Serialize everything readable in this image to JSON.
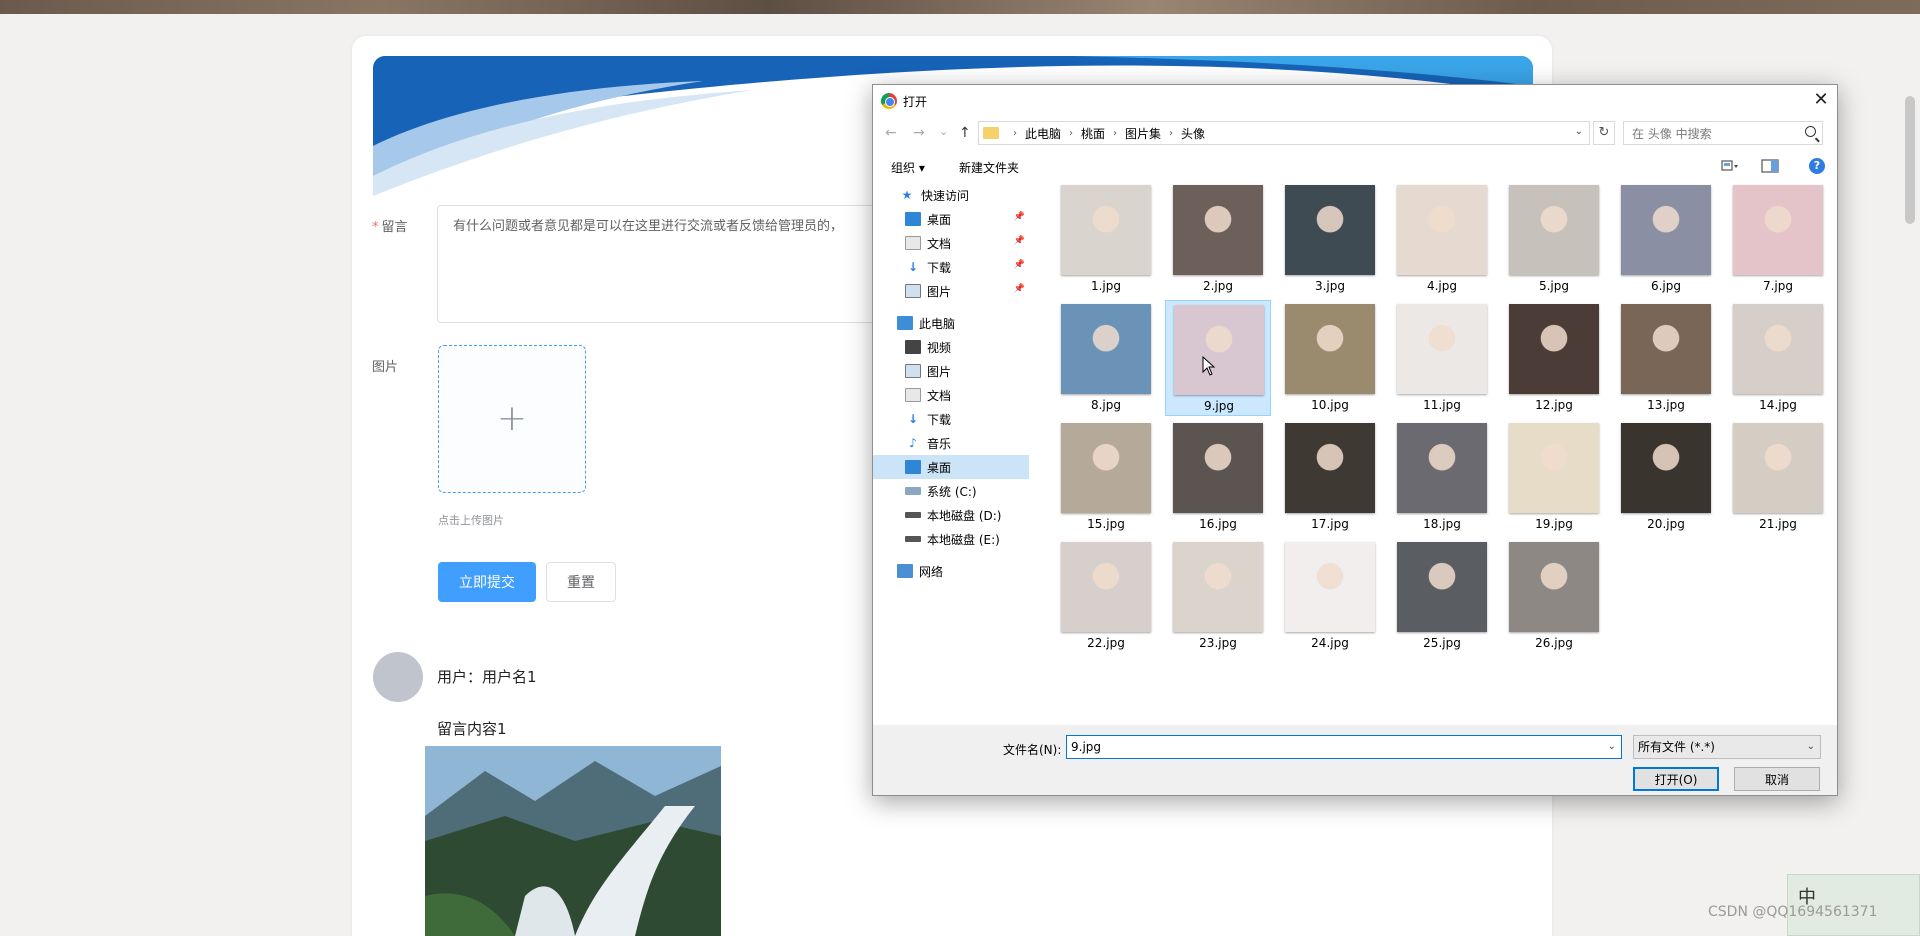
{
  "page": {
    "form": {
      "message_label": "留言",
      "message_placeholder": "有什么问题或者意见都是可以在这里进行交流或者反馈给管理员的，",
      "image_label": "图片",
      "upload_plus": "+",
      "upload_tip": "点击上传图片",
      "submit_label": "立即提交",
      "reset_label": "重置"
    },
    "comment": {
      "user": "用户：用户名1",
      "content": "留言内容1"
    }
  },
  "dialog": {
    "title": "打开",
    "close": "✕",
    "nav": {
      "back": "←",
      "forward": "→",
      "recent": "⌄",
      "up": "↑"
    },
    "breadcrumbs": [
      "此电脑",
      "桃面",
      "图片集",
      "头像"
    ],
    "refresh": "↻",
    "search_placeholder": "在 头像 中搜索",
    "toolbar": {
      "organize": "组织 ▾",
      "new_folder": "新建文件夹",
      "help": "?"
    },
    "sidebar": [
      {
        "label": "快速访问",
        "icon": "star-icon"
      },
      {
        "label": "桌面",
        "icon": "desktop-icon",
        "pinned": true
      },
      {
        "label": "文档",
        "icon": "document-icon",
        "pinned": true
      },
      {
        "label": "下载",
        "icon": "download-icon",
        "pinned": true
      },
      {
        "label": "图片",
        "icon": "picture-icon",
        "pinned": true
      },
      {
        "label": "此电脑",
        "icon": "computer-icon"
      },
      {
        "label": "视频",
        "icon": "video-icon"
      },
      {
        "label": "图片",
        "icon": "picture-icon"
      },
      {
        "label": "文档",
        "icon": "document-icon"
      },
      {
        "label": "下载",
        "icon": "download-icon"
      },
      {
        "label": "音乐",
        "icon": "music-icon"
      },
      {
        "label": "桌面",
        "icon": "desktop-icon",
        "selected": true
      },
      {
        "label": "系统 (C:)",
        "icon": "drive-icon"
      },
      {
        "label": "本地磁盘 (D:)",
        "icon": "drive-icon"
      },
      {
        "label": "本地磁盘 (E:)",
        "icon": "drive-icon"
      },
      {
        "label": "网络",
        "icon": "network-icon"
      }
    ],
    "files": [
      {
        "name": "1.jpg",
        "color": "#d9d4cd"
      },
      {
        "name": "2.jpg",
        "color": "#6d5f5a"
      },
      {
        "name": "3.jpg",
        "color": "#3f4b52"
      },
      {
        "name": "4.jpg",
        "color": "#e6d9cf"
      },
      {
        "name": "5.jpg",
        "color": "#c7c1bc"
      },
      {
        "name": "6.jpg",
        "color": "#8a8fa3"
      },
      {
        "name": "7.jpg",
        "color": "#e4c4c9"
      },
      {
        "name": "8.jpg",
        "color": "#6b93b8"
      },
      {
        "name": "9.jpg",
        "color": "#d8c7d0",
        "selected": true
      },
      {
        "name": "10.jpg",
        "color": "#9a8a6e"
      },
      {
        "name": "11.jpg",
        "color": "#ece8e6"
      },
      {
        "name": "12.jpg",
        "color": "#4b3c37"
      },
      {
        "name": "13.jpg",
        "color": "#7a6657"
      },
      {
        "name": "14.jpg",
        "color": "#d6cfc9"
      },
      {
        "name": "15.jpg",
        "color": "#b5a999"
      },
      {
        "name": "16.jpg",
        "color": "#5b5451"
      },
      {
        "name": "17.jpg",
        "color": "#3e3a33"
      },
      {
        "name": "18.jpg",
        "color": "#6a6a70"
      },
      {
        "name": "19.jpg",
        "color": "#e7dcc8"
      },
      {
        "name": "20.jpg",
        "color": "#3a342e"
      },
      {
        "name": "21.jpg",
        "color": "#d5cdc3"
      },
      {
        "name": "22.jpg",
        "color": "#d6cfcb"
      },
      {
        "name": "23.jpg",
        "color": "#dad4cc"
      },
      {
        "name": "24.jpg",
        "color": "#f2eeee"
      },
      {
        "name": "25.jpg",
        "color": "#5a5e62"
      },
      {
        "name": "26.jpg",
        "color": "#8d8884"
      }
    ],
    "filename_label": "文件名(N):",
    "filename_value": "9.jpg",
    "filetype": "所有文件 (*.*)",
    "open_button": "打开(O)",
    "cancel_button": "取消"
  },
  "overlay": {
    "watermark": "CSDN @QQ1694561371",
    "ime_char": "中"
  },
  "colors": {
    "primary": "#409eff",
    "selection": "#cce8ff",
    "dialog_accent": "#0078d7"
  }
}
